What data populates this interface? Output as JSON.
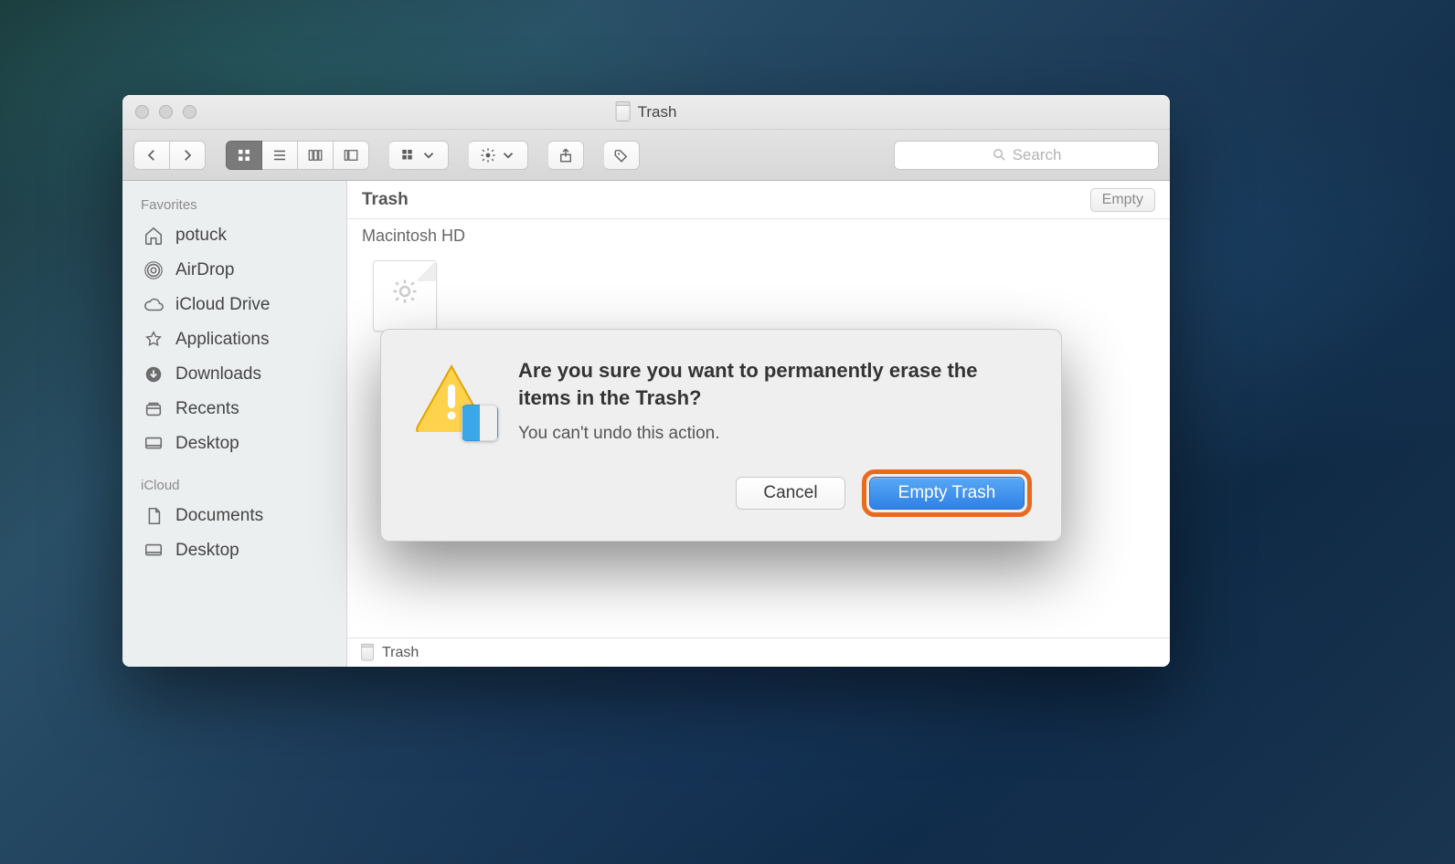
{
  "window": {
    "title": "Trash"
  },
  "toolbar": {
    "search_placeholder": "Search"
  },
  "sidebar": {
    "sections": [
      {
        "header": "Favorites",
        "items": [
          {
            "icon": "home-icon",
            "label": "potuck"
          },
          {
            "icon": "airdrop-icon",
            "label": "AirDrop"
          },
          {
            "icon": "cloud-icon",
            "label": "iCloud Drive"
          },
          {
            "icon": "applications-icon",
            "label": "Applications"
          },
          {
            "icon": "downloads-icon",
            "label": "Downloads"
          },
          {
            "icon": "recents-icon",
            "label": "Recents"
          },
          {
            "icon": "desktop-icon",
            "label": "Desktop"
          }
        ]
      },
      {
        "header": "iCloud",
        "items": [
          {
            "icon": "documents-icon",
            "label": "Documents"
          },
          {
            "icon": "desktop-icon",
            "label": "Desktop"
          }
        ]
      }
    ]
  },
  "content": {
    "title": "Trash",
    "empty_button": "Empty",
    "section": "Macintosh HD"
  },
  "pathbar": {
    "label": "Trash"
  },
  "dialog": {
    "title": "Are you sure you want to permanently erase the items in the Trash?",
    "message": "You can't undo this action.",
    "cancel": "Cancel",
    "confirm": "Empty Trash"
  }
}
